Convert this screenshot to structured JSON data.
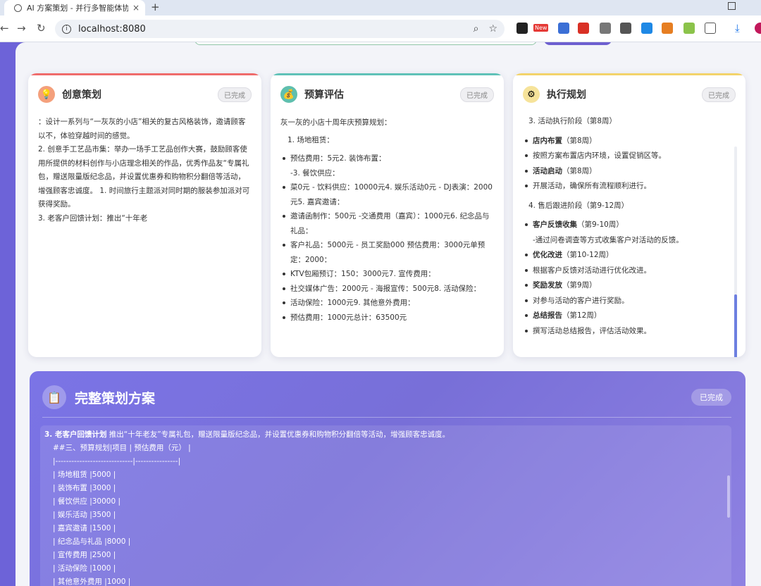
{
  "browser": {
    "tab_title": "AI 方案策划 - 并行多智能体协作",
    "tab_close": "×",
    "new_tab": "+",
    "url": "localhost:8080",
    "extension_new_label": "New"
  },
  "cards": [
    {
      "title": "创意策划",
      "status": "已完成",
      "icon": "lightbulb-icon",
      "accent": "#ef6b6b",
      "paragraphs": [
        "：设计一系列与“一灰灰的小店”相关的复古风格装饰，邀请顾客以不，体验穿越时间的感觉。",
        "2. 创意手工艺品市集：举办一场手工艺品创作大赛，鼓励顾客使用所提供的材料创作与小店理念相关的作品，优秀作品友“专属礼包，赠送限量版纪念品，并设置优惠券和购物积分翻倍等活动，增强顾客忠诚度。 1. 时间旅行主题派对同时期的服装参加派对可获得奖励。",
        "3. 老客户回馈计划：推出“十年老"
      ]
    },
    {
      "title": "预算评估",
      "status": "已完成",
      "icon": "money-bag-icon",
      "accent": "#5fc2b8",
      "intro": "灰一灰的小店十周年庆预算规划：",
      "subhead": "1. 场地租赁：",
      "items": [
        "预估费用：5元2. 装饰布置：\n-3. 餐饮供应：",
        "菜0元 - 饮料供应：10000元4. 娱乐活动0元 - DJ表演：2000元5. 嘉宾邀请：",
        "邀请函制作：500元 -交通费用（嘉宾）：1000元6. 纪念品与礼品：",
        "客户礼品：5000元 - 员工奖励000 预估费用：3000元单预定：2000：",
        "KTV包厢预订：150：3000元7. 宣传费用：",
        "社交媒体广告：2000元 - 海报宣传：500元8. 活动保险：",
        "活动保险：1000元9. 其他意外费用：",
        "预估费用：1000元总计：63500元"
      ]
    },
    {
      "title": "执行规划",
      "status": "已完成",
      "icon": "gear-icon",
      "accent": "#f3d36a",
      "phase3": "3. 活动执行阶段（第8周）",
      "phase3_items": [
        {
          "bold": "店内布置",
          "text": "（第8周）"
        },
        {
          "bold": "",
          "text": "按照方案布置店内环境，设置促销区等。"
        },
        {
          "bold": "活动启动",
          "text": "（第8周）"
        },
        {
          "bold": "",
          "text": "开展活动，确保所有流程顺利进行。"
        }
      ],
      "phase4": "4. 售后跟进阶段（第9-12周）",
      "phase4_items": [
        {
          "bold": "客户反馈收集",
          "text": "（第9-10周）",
          "sub": "-通过问卷调查等方式收集客户对活动的反馈。"
        },
        {
          "bold": "优化改进",
          "text": "（第10-12周）"
        },
        {
          "bold": "",
          "text": "根据客户反馈对活动进行优化改进。"
        },
        {
          "bold": "奖励发放",
          "text": "（第9周）"
        },
        {
          "bold": "",
          "text": "对参与活动的客户进行奖励。"
        },
        {
          "bold": "总结报告",
          "text": "（第12周）"
        },
        {
          "bold": "",
          "text": "撰写活动总结报告，评估活动效果。"
        }
      ]
    }
  ],
  "plan": {
    "title": "完整策划方案",
    "status": "已完成",
    "icon": "clipboard-icon",
    "first_line_bold": "3. 老客户回馈计划",
    "first_line_rest": " 推出“十年老友”专属礼包，赠送限量版纪念品，并设置优惠券和购物积分翻倍等活动，增强顾客忠诚度。",
    "lines": [
      "##三、预算规划|项目 | 预估费用（元） |",
      "|-----------------------------|----------------|",
      "| 场地租赁 |5000 |",
      "| 装饰布置 |3000 |",
      "| 餐饮供应 |30000 |",
      "| 娱乐活动 |3500 |",
      "| 嘉宾邀请 |1500 |",
      "| 纪念品与礼品 |8000 |",
      "| 宣传费用 |2500 |",
      "| 活动保险 |1000 |",
      "| 其他意外费用 |1000 |"
    ]
  }
}
